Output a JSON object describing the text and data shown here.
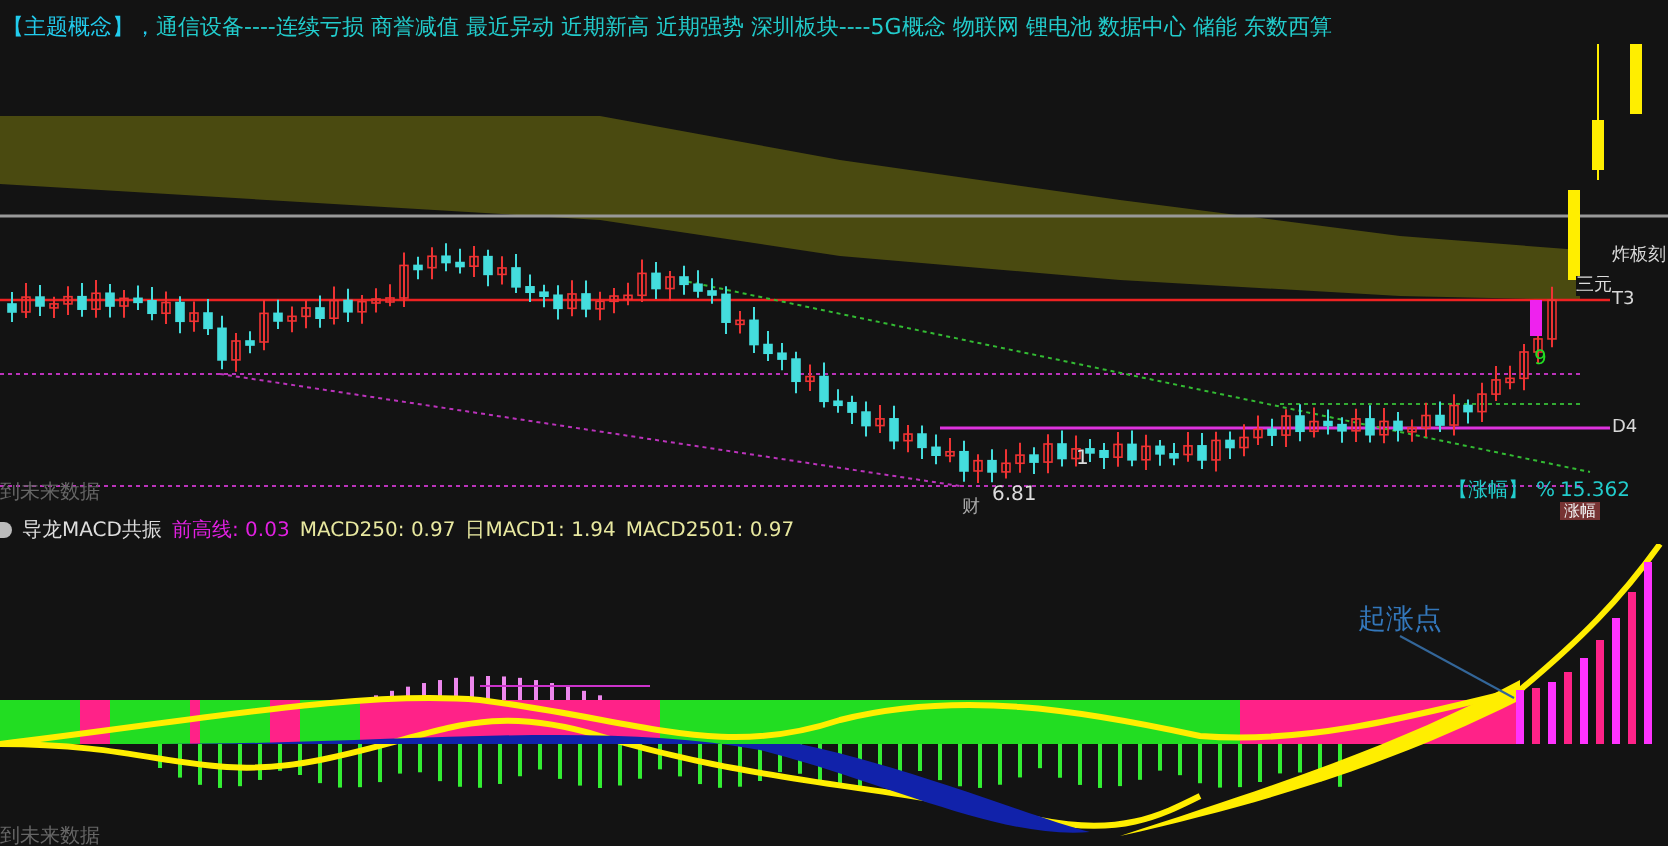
{
  "concept_bar": {
    "label": "【主题概念】，",
    "text": "通信设备----连续亏损 商誉减值 最近异动 近期新高 近期强势 深圳板块----5G概念 物联网 锂电池 数据中心 储能 东数西算"
  },
  "price_chart": {
    "line_tags": [
      {
        "kind": "upper",
        "text": "炸板刻"
      },
      {
        "kind": "middle",
        "text": "T3"
      },
      {
        "kind": "lower",
        "text": "D4"
      }
    ],
    "markers": {
      "pattern": "三元",
      "signal": "9",
      "low_price": "6.81",
      "count": "1",
      "bottom_mark": "财"
    },
    "gain": {
      "label": "【涨幅】",
      "unit": "%",
      "value": "15.362",
      "badge": "涨幅"
    },
    "future_note": "到未来数据"
  },
  "indicator": {
    "name": "导龙MACD共振",
    "values": [
      {
        "label": "前高线:",
        "value": "0.03",
        "color": "#e020e0"
      },
      {
        "label": "MACD250:",
        "value": "0.97",
        "color": "#e8e8a0"
      },
      {
        "label": "日MACD1:",
        "value": "1.94",
        "color": "#e8e8a0"
      },
      {
        "label": "MACD2501:",
        "value": "0.97",
        "color": "#e8e8a0"
      }
    ],
    "annotation": "起涨点",
    "future_note": "到未来数据"
  }
}
